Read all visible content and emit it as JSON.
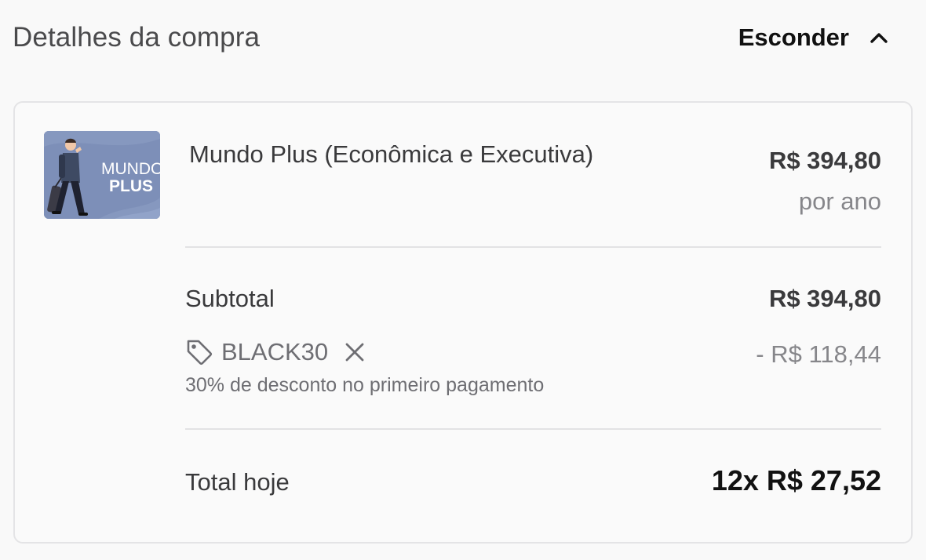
{
  "header": {
    "title": "Detalhes da compra",
    "toggle_label": "Esconder",
    "toggle_icon": "chevron-up-icon"
  },
  "product": {
    "image": {
      "icon": "product-thumbnail",
      "line1": "MUNDO",
      "line2": "PLUS",
      "background": "#7d8fb8"
    },
    "name": "Mundo Plus (Econômica e Executiva)",
    "price": "R$ 394,80",
    "period": "por ano"
  },
  "summary": {
    "subtotal_label": "Subtotal",
    "subtotal_value": "R$ 394,80",
    "coupon": {
      "icon": "tag-icon",
      "code": "BLACK30",
      "remove_icon": "close-icon",
      "discount": "- R$ 118,44",
      "description": "30% de desconto no primeiro pagamento"
    },
    "total_label": "Total hoje",
    "total_value": "12x R$ 27,52"
  },
  "colors": {
    "background": "#f9f9f9",
    "card_border": "#e4e4e6",
    "text_primary": "#3a3a3c",
    "text_muted": "#86868a",
    "text_strong": "#111111"
  }
}
